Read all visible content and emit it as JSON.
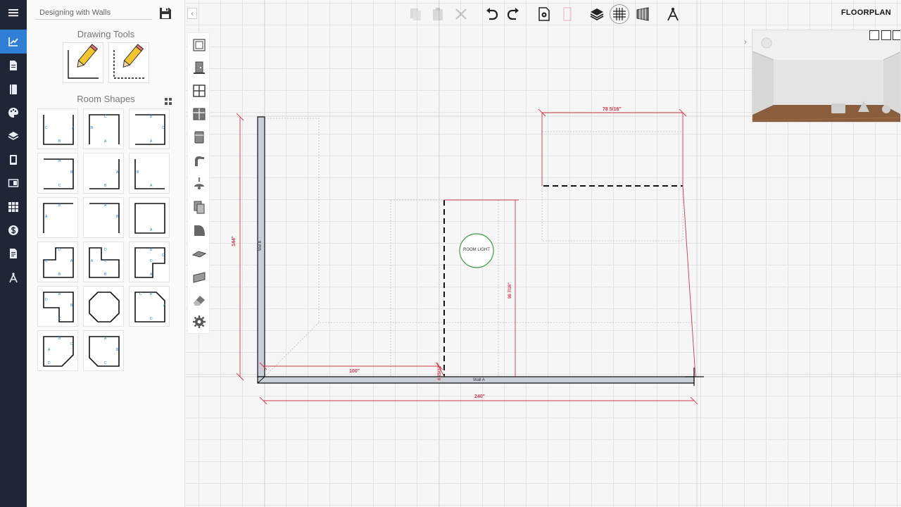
{
  "project": {
    "name": "Designing with Walls"
  },
  "side_panel": {
    "drawing_tools_heading": "Drawing Tools",
    "room_shapes_heading": "Room Shapes"
  },
  "view": {
    "label": "FLOORPLAN"
  },
  "plan": {
    "walls": [
      {
        "label": "Wall A"
      },
      {
        "label": "Wall B"
      }
    ],
    "fixture_label": "ROOM LIGHT",
    "dimensions": {
      "wall_a_length": "240\"",
      "wall_b_length": "144\"",
      "segment_left": "100\"",
      "segment_small": "6 25/32\"",
      "opening_height": "98 7/16\"",
      "rect_width": "78 5/16\""
    }
  },
  "colors": {
    "nav_bg": "#1f2736",
    "nav_active": "#2f7fd6",
    "dimension_red": "#d2374f",
    "wall_fill": "#c9ced9",
    "pencil_yellow": "#f4c52a",
    "shape_label_blue": "#2a7bd1"
  },
  "icons": {
    "nav": [
      "menu-icon",
      "chart-line-icon",
      "document-icon",
      "book-icon",
      "palette-icon",
      "layers-icon",
      "tablet-icon",
      "panel-icon",
      "grid-icon",
      "dollar-icon",
      "report-icon",
      "compass-icon"
    ],
    "toolbar": [
      "copy-icon",
      "paste-icon",
      "delete-icon",
      "undo-icon",
      "redo-icon",
      "settings-document-icon",
      "door-icon",
      "layers-icon",
      "grid-icon",
      "wall-3d-icon",
      "measure-icon"
    ]
  }
}
